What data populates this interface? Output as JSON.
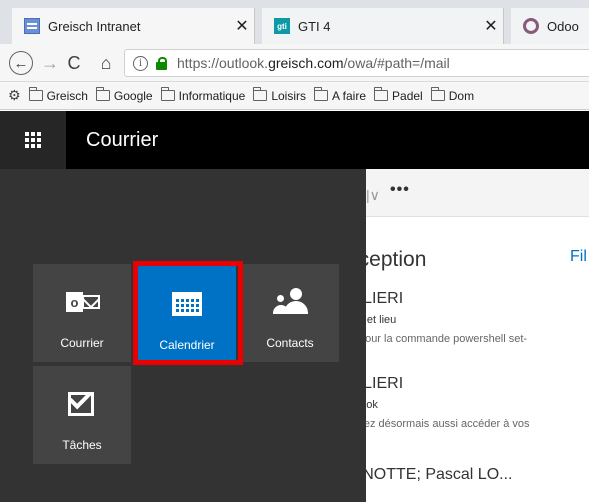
{
  "browser": {
    "tabs": [
      {
        "title": "Greisch Intranet",
        "close": "✕",
        "favicon": "intranet-favicon"
      },
      {
        "title": "GTI 4",
        "close": "✕",
        "favicon": "gti-favicon",
        "favicon_text": "gti"
      },
      {
        "title": "Odoo",
        "favicon": "odoo-favicon"
      }
    ],
    "nav": {
      "back": "←",
      "forward": "→",
      "reload": "C",
      "home": "⌂",
      "info": "i"
    },
    "url": {
      "prefix": "https://outlook.",
      "host": "greisch.com",
      "path": "/owa/#path=/mail"
    },
    "bookmarks": [
      "Greisch",
      "Google",
      "Informatique",
      "Loisirs",
      "A faire",
      "Padel",
      "Dom"
    ]
  },
  "owa": {
    "title": "Courrier"
  },
  "mail": {
    "cmd_sep": "|∨",
    "cmd_more": "•••",
    "folder_title": "réception",
    "filter": "Fil",
    "messages": [
      {
        "from": "VOLIERI",
        "subject": "objet et lieu",
        "preview": "rde pour la commande powershell set-"
      },
      {
        "from": "VOLIERI",
        "subject": "Outlook",
        "preview": "pouvez désormais aussi accéder à vos"
      },
      {
        "from": "ARNOTTE; Pascal LO..."
      }
    ]
  },
  "launcher": {
    "tiles": [
      {
        "label": "Courrier",
        "icon": "outlook-mail-icon",
        "active": false
      },
      {
        "label": "Calendrier",
        "icon": "calendar-icon",
        "active": true
      },
      {
        "label": "Contacts",
        "icon": "people-icon",
        "active": false
      },
      {
        "label": "Tâches",
        "icon": "tasks-checkbox-icon",
        "active": false
      }
    ],
    "highlight_color": "#ea0000",
    "accent_color": "#0072c6"
  }
}
